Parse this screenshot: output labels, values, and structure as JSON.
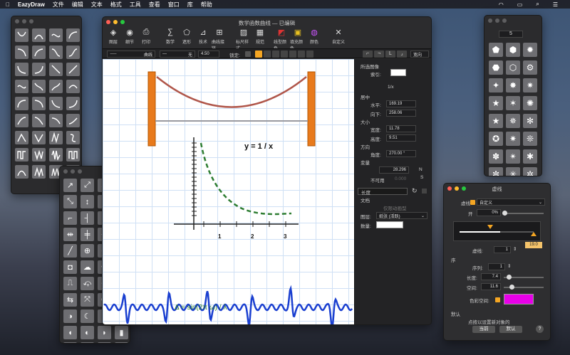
{
  "menubar": {
    "apple": "",
    "app": "EazyDraw",
    "items": [
      "文件",
      "编辑",
      "文本",
      "格式",
      "工具",
      "查看",
      "窗口",
      "库",
      "帮助"
    ]
  },
  "main": {
    "title": "数学函数曲线 — 已编辑",
    "toolbar": [
      "图层",
      "细节",
      "打印",
      "数学",
      "遮形",
      "技术",
      "曲线接链",
      "标尺样式",
      "规范",
      "线型颜色",
      "填充颜色",
      "颜色",
      "自定义"
    ],
    "style_bar": {
      "line_style": "曲线",
      "arrow": "无",
      "width": "4.50",
      "lock": "锁定:",
      "orient": "宽向"
    },
    "canvas": {
      "equation": "y = 1 / x",
      "wave_label": "Δ = sin(2π ω) / λ",
      "ticks": [
        "1",
        "2",
        "3"
      ]
    },
    "props": {
      "selected": "所选图像",
      "index_label": "索引:",
      "fraction": "1/x",
      "center": "居中",
      "h_label": "水平:",
      "h_val": "169.19",
      "v_label": "向下:",
      "v_val": "258.06",
      "size": "大小",
      "w_label": "宽度:",
      "w_val": "11.78",
      "ht_label": "高度:",
      "ht_val": "9.51",
      "dir": "方向",
      "angle_label": "角度:",
      "angle_val": "270.00 °",
      "var": "变量",
      "pct_val": "28.296",
      "n_label": "N",
      "unavail": "不可用",
      "unavail_val": "0.000",
      "s_label": "S",
      "length": "长度",
      "doc": "文档",
      "doc_msg": "仅限动画型",
      "layer_label": "图层:",
      "layer_val": "纸张 (活跃)",
      "count_label": "数量:"
    }
  },
  "shapes_panel": {
    "count": "5"
  },
  "line_panel": {
    "title": "虚线",
    "dash_label": "虚线",
    "dash_val": "自定义",
    "open": "开",
    "pct": "0%",
    "slider_val": "19.0",
    "dash_count_label": "虚线:",
    "dash_count": "1",
    "seq": "序",
    "seq_label": "序列:",
    "seq_val": "1",
    "len_label": "长度:",
    "len_val": "7.4",
    "space_label": "空间:",
    "space_val": "11.6",
    "color_label": "色彩空间:",
    "color": "#e800e8",
    "default": "默认",
    "hint": "点按以设置新对象的",
    "current": "当前",
    "reset": "默认",
    "help": "?"
  }
}
